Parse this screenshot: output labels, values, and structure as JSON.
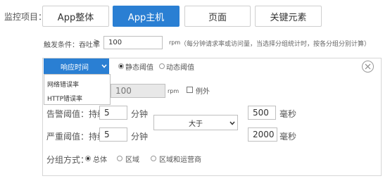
{
  "monitor": {
    "label": "监控项目：",
    "tabs": [
      {
        "label": "App整体",
        "active": false
      },
      {
        "label": "App主机",
        "active": true
      },
      {
        "label": "页面",
        "active": false
      },
      {
        "label": "关键元素",
        "active": false
      }
    ]
  },
  "trigger": {
    "label": "触发条件：吞吐率",
    "operator": "≥",
    "value": "100",
    "unit": "rpm",
    "hint": "（每分钟请求率或访问量，当选择分组统计时，按各分组分别计算）"
  },
  "metric_dropdown": {
    "selected": "响应时间",
    "options": [
      "网络错误率",
      "HTTP错误率"
    ]
  },
  "threshold_mode": {
    "static_label": "静态阈值",
    "dynamic_label": "动态阈值",
    "selected": "static"
  },
  "throughput": {
    "value": "100",
    "unit": "rpm",
    "exception_label": "例外"
  },
  "warning": {
    "label": "告警阈值：持续",
    "duration": "5",
    "duration_unit": "分钟",
    "value": "500",
    "value_unit": "毫秒"
  },
  "critical": {
    "label": "严重阈值：持续",
    "duration": "5",
    "duration_unit": "分钟",
    "value": "2000",
    "value_unit": "毫秒"
  },
  "comparison": {
    "selected": "大于"
  },
  "grouping": {
    "label": "分组方式：",
    "options": [
      "总体",
      "区域",
      "区域和运营商"
    ],
    "selected": "总体"
  },
  "colors": {
    "accent": "#2a7fd3",
    "border": "#bfbfbf"
  }
}
